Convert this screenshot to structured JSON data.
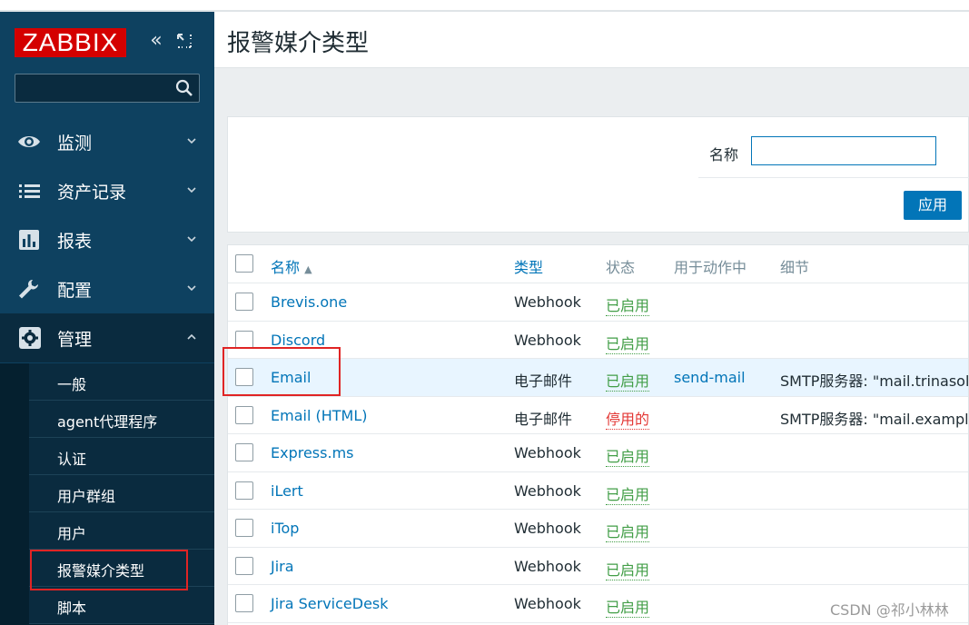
{
  "sidebar": {
    "logo": "ZABBIX",
    "collapse_icon": "double-chevron-left-icon",
    "kiosk_icon": "expand-icon",
    "search": {
      "value": "",
      "placeholder": ""
    },
    "menu": [
      {
        "label": "监测",
        "icon": "eye-icon",
        "expanded": false
      },
      {
        "label": "资产记录",
        "icon": "list-icon",
        "expanded": false
      },
      {
        "label": "报表",
        "icon": "bar-chart-icon",
        "expanded": false
      },
      {
        "label": "配置",
        "icon": "wrench-icon",
        "expanded": false
      },
      {
        "label": "管理",
        "icon": "gear-icon",
        "expanded": true
      }
    ],
    "submenu": [
      "一般",
      "agent代理程序",
      "认证",
      "用户群组",
      "用户",
      "报警媒介类型",
      "脚本"
    ]
  },
  "page": {
    "title": "报警媒介类型"
  },
  "filter": {
    "name_label": "名称",
    "name_value": "",
    "apply_label": "应用"
  },
  "table": {
    "headers": {
      "name": "名称",
      "sort_indicator": "▲",
      "type": "类型",
      "status": "状态",
      "used_in_actions": "用于动作中",
      "details": "细节"
    },
    "rows": [
      {
        "name": "Brevis.one",
        "type": "Webhook",
        "status": "已启用",
        "enabled": true,
        "action": "",
        "details": ""
      },
      {
        "name": "Discord",
        "type": "Webhook",
        "status": "已启用",
        "enabled": true,
        "action": "",
        "details": ""
      },
      {
        "name": "Email",
        "type": "电子邮件",
        "status": "已启用",
        "enabled": true,
        "action": "send-mail",
        "details": "SMTP服务器: \"mail.trinasolar"
      },
      {
        "name": "Email (HTML)",
        "type": "电子邮件",
        "status": "停用的",
        "enabled": false,
        "action": "",
        "details": "SMTP服务器: \"mail.example.c"
      },
      {
        "name": "Express.ms",
        "type": "Webhook",
        "status": "已启用",
        "enabled": true,
        "action": "",
        "details": ""
      },
      {
        "name": "iLert",
        "type": "Webhook",
        "status": "已启用",
        "enabled": true,
        "action": "",
        "details": ""
      },
      {
        "name": "iTop",
        "type": "Webhook",
        "status": "已启用",
        "enabled": true,
        "action": "",
        "details": ""
      },
      {
        "name": "Jira",
        "type": "Webhook",
        "status": "已启用",
        "enabled": true,
        "action": "",
        "details": ""
      },
      {
        "name": "Jira ServiceDesk",
        "type": "Webhook",
        "status": "已启用",
        "enabled": true,
        "action": "",
        "details": ""
      }
    ]
  },
  "watermark": "CSDN @祁小林林",
  "colors": {
    "sidebar": "#0e4160",
    "logo_red": "#d40000",
    "link_blue": "#0275b8",
    "enabled_green": "#429e47",
    "disabled_red": "#e33734",
    "annotation_red": "#e02424"
  }
}
